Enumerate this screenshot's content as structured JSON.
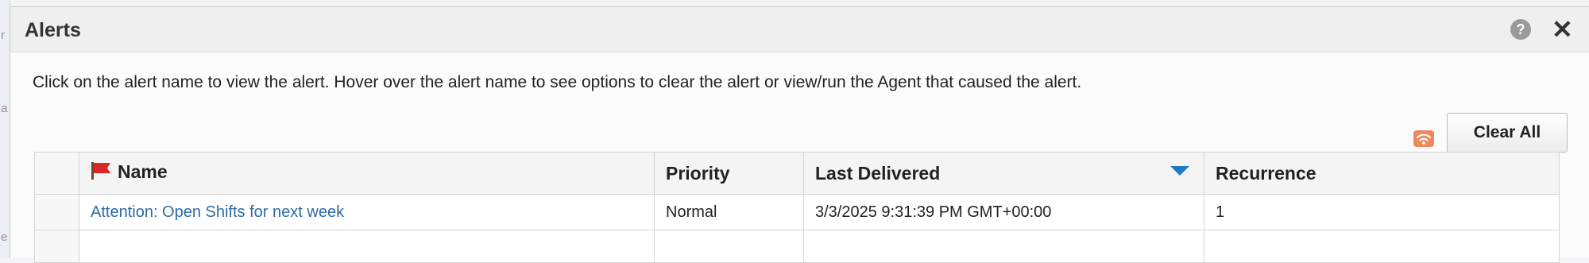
{
  "dialog": {
    "title": "Alerts",
    "instructions": "Click on the alert name to view the alert. Hover over the alert name to see options to clear the alert or view/run the Agent that caused the alert.",
    "help_icon": "question-circle-icon",
    "help_glyph": "?",
    "close_icon": "close-icon",
    "close_glyph": "✕"
  },
  "toolbar": {
    "rss_icon": "rss-feed-icon",
    "clear_all_label": "Clear All"
  },
  "table": {
    "columns": {
      "name": "Name",
      "priority": "Priority",
      "last_delivered": "Last Delivered",
      "recurrence": "Recurrence"
    },
    "sort": {
      "column": "last_delivered",
      "direction": "descending"
    },
    "rows": [
      {
        "name": "Attention: Open Shifts for next week",
        "priority": "Normal",
        "last_delivered": "3/3/2025 9:31:39 PM GMT+00:00",
        "recurrence": "1"
      }
    ]
  },
  "colors": {
    "link": "#2d6aa8",
    "sort_indicator": "#1f7bc4",
    "rss_icon": "#f0875f",
    "flag": "#d8262b"
  }
}
